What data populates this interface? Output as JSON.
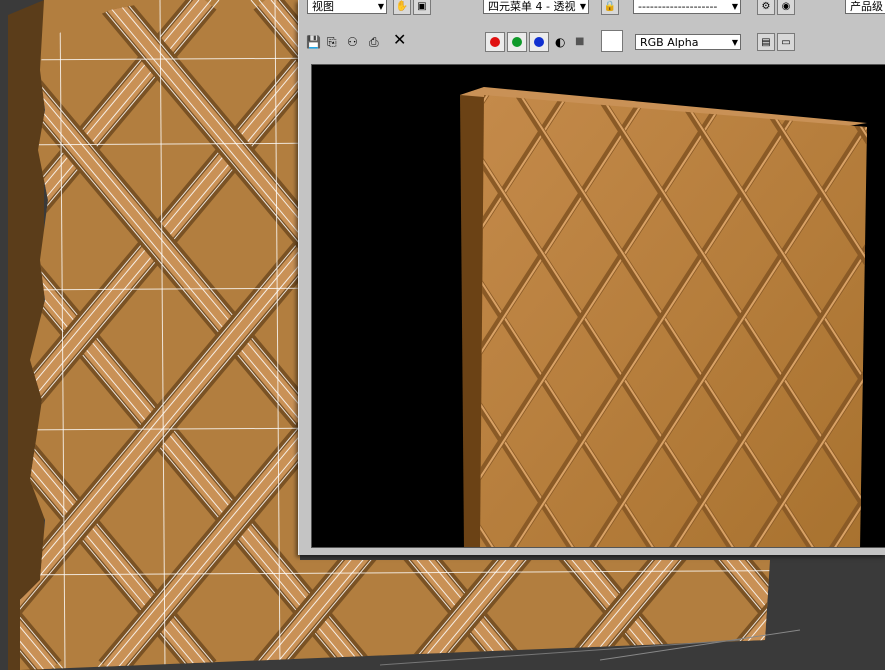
{
  "toolbar_row1": {
    "view_dropdown": "视图",
    "viewport_dropdown": "四元菜单 4 - 透视",
    "preset_dropdown": "--------------------",
    "product_level": "产品级"
  },
  "toolbar_row2": {
    "channel_dropdown": "RGB Alpha"
  },
  "colors": {
    "tile": "#b27e3f",
    "tile_light": "#c99156",
    "groove": "#7a5224",
    "wire": "#ffffff",
    "panel_bg": "#c4c4c4"
  }
}
